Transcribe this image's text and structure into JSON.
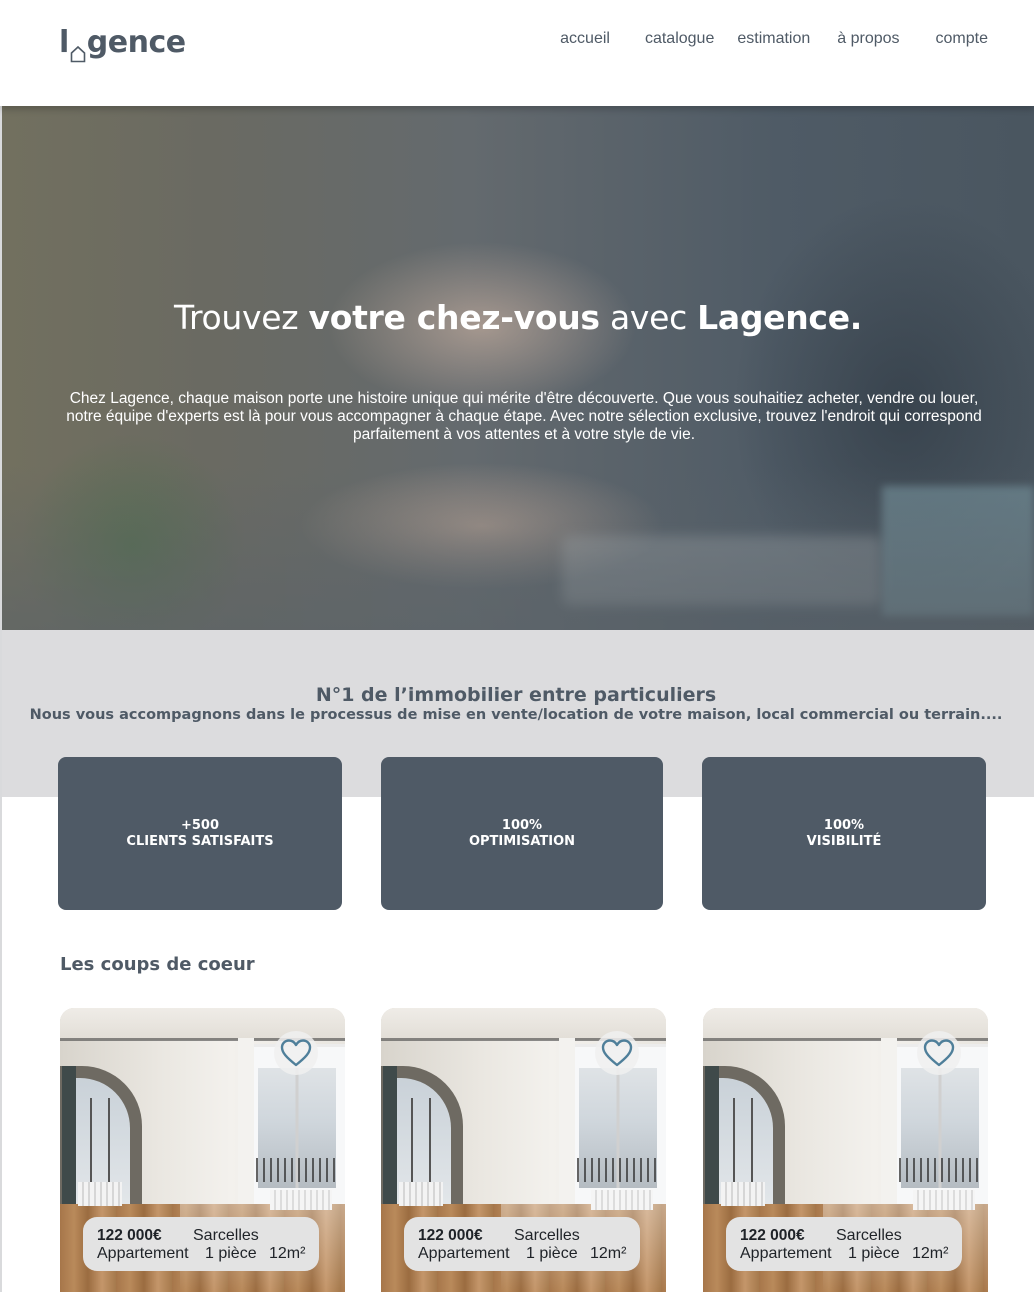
{
  "header": {
    "logo_text_start": "l",
    "logo_text_end": "gence",
    "nav": [
      "accueil",
      "catalogue",
      "estimation",
      "à propos",
      "compte"
    ]
  },
  "hero": {
    "title_part1": "Trouvez ",
    "title_bold1": "votre chez-vous",
    "title_part2": " avec ",
    "title_bold2": "Lagence.",
    "text": "Chez Lagence, chaque maison porte une histoire unique qui mérite d'être découverte. Que vous souhaitiez acheter, vendre ou louer, notre équipe d'experts est là pour vous accompagner à chaque étape. Avec notre sélection exclusive, trouvez l'endroit qui correspond parfaitement à vos attentes et à votre style de vie."
  },
  "tagline": {
    "title": "N°1 de l’immobilier entre particuliers",
    "subtitle": "Nous vous accompagnons dans le processus de mise en vente/location de votre maison, local commercial ou terrain...."
  },
  "stats": [
    {
      "value": "+500",
      "label": "CLIENTS SATISFAITS"
    },
    {
      "value": "100%",
      "label": "OPTIMISATION"
    },
    {
      "value": "100%",
      "label": "VISIBILITÉ"
    }
  ],
  "favorites": {
    "title": "Les coups de coeur",
    "listings": [
      {
        "price": "122 000€",
        "city": "Sarcelles",
        "type": "Appartement",
        "rooms": "1 pièce",
        "area": "12m²"
      },
      {
        "price": "122 000€",
        "city": "Sarcelles",
        "type": "Appartement",
        "rooms": "1 pièce",
        "area": "12m²"
      },
      {
        "price": "122 000€",
        "city": "Sarcelles",
        "type": "Appartement",
        "rooms": "1 pièce",
        "area": "12m²"
      }
    ]
  },
  "colors": {
    "primary": "#4f5a66",
    "band": "#dcdcde",
    "heart": "#4f7f9a"
  },
  "icons": {
    "logo_house": "house-icon",
    "favorite": "heart-icon"
  }
}
